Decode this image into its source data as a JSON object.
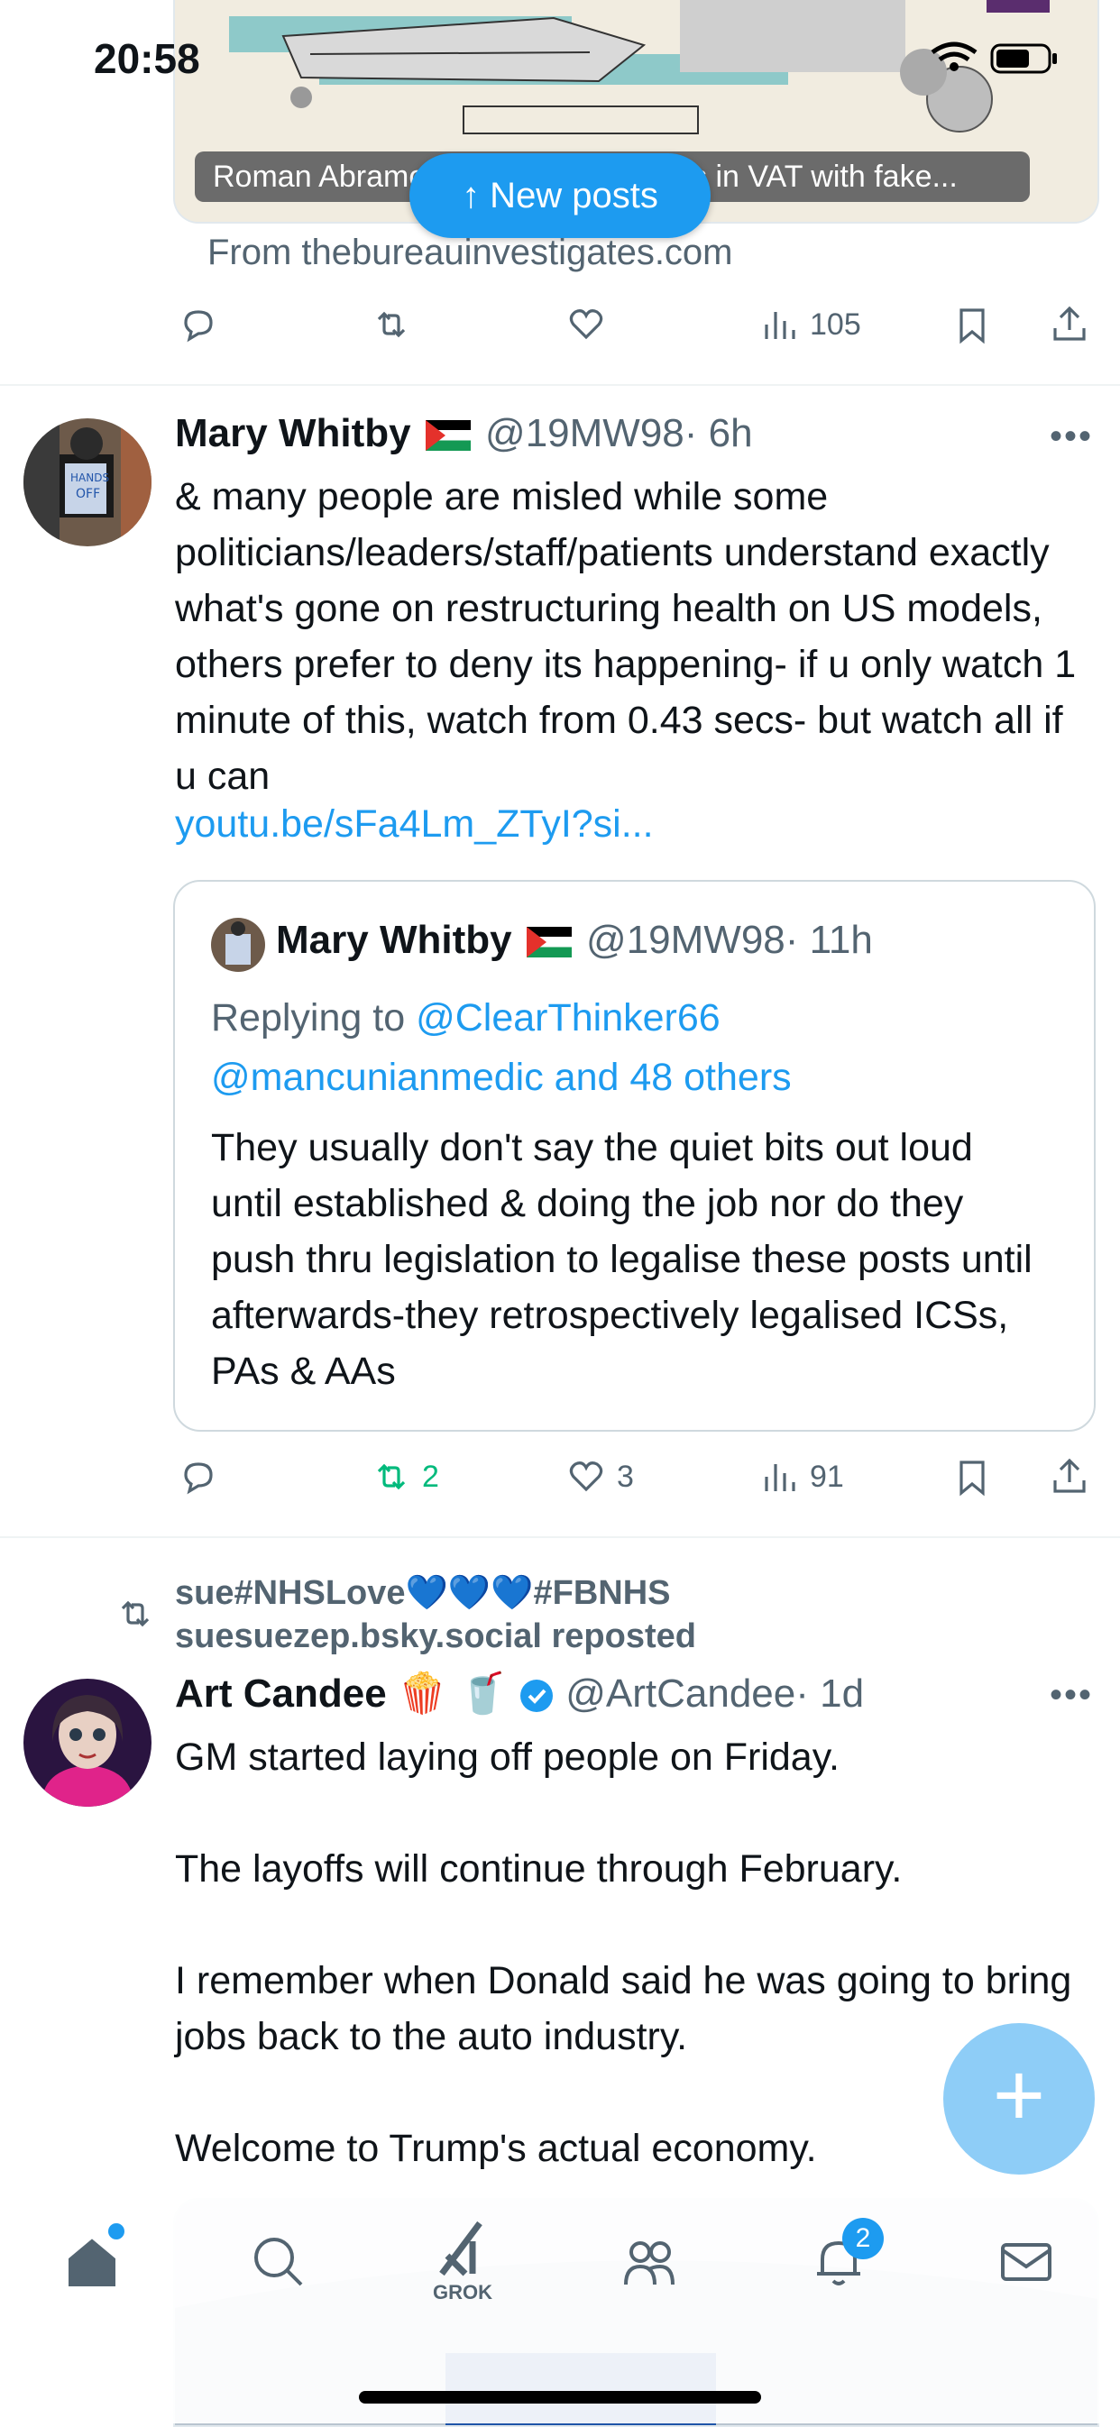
{
  "status_bar": {
    "time": "20:58"
  },
  "top_post": {
    "card_caption": "Roman Abramovich avoided millions in VAT with fake...",
    "card_source": "From thebureauinvestigates.com",
    "views": "105"
  },
  "new_posts_button": {
    "label": "↑ New posts"
  },
  "post1": {
    "author": "Mary Whitby",
    "handle": "@19MW98",
    "time": "· 6h",
    "text": "& many people are misled while some politicians/leaders/staff/patients understand exactly what's gone on restructuring health on US models, others prefer to deny its happening- if u only watch 1 minute of this, watch from 0.43 secs- but watch all if u can",
    "link": "youtu.be/sFa4Lm_ZTyI?si...",
    "quote": {
      "author": "Mary Whitby",
      "handle": "@19MW98",
      "time": "· 11h",
      "replying_prefix": "Replying to ",
      "replying_user": "@ClearThinker66",
      "replying_rest": "@mancunianmedic and 48 others",
      "text": "They usually don't say the quiet bits out loud until established & doing the job nor do they push thru legislation to legalise these posts until afterwards-they retrospectively legalised ICSs, PAs & AAs"
    },
    "reposts": "2",
    "likes": "3",
    "views": "91"
  },
  "post2": {
    "repost_line1": "sue#NHSLove💙💙💙#FBNHS",
    "repost_line2": "suesuezep.bsky.social reposted",
    "author": "Art Candee",
    "author_emoji": "🍿 🥤",
    "handle": "@ArtCandee",
    "time": "· 1d",
    "p1": "GM started laying off people on Friday.",
    "p2": "The layoffs will continue through February.",
    "p3": "I remember when Donald said he was going to bring jobs back to the auto industry.",
    "p4": "Welcome to Trump's actual economy."
  },
  "tabbar": {
    "grok_label": "GROK",
    "notification_count": "2"
  },
  "colors": {
    "accent": "#1d9bf0",
    "repost_green": "#00ba7c",
    "text": "#0f1419",
    "muted": "#536471"
  }
}
